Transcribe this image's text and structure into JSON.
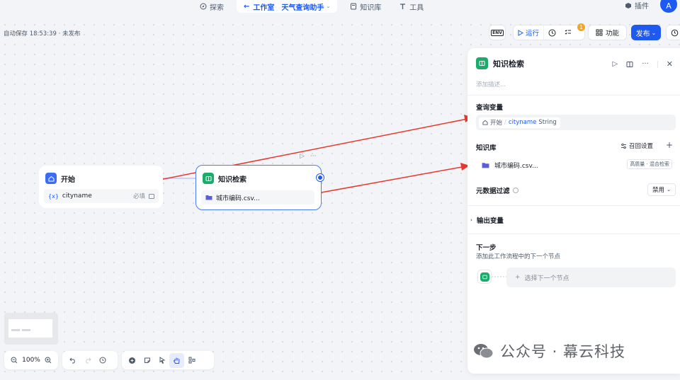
{
  "topnav": {
    "explore_label": "探索",
    "workspace_label": "工作室",
    "app_name": "天气查询助手",
    "knowledge_label": "知识库",
    "tools_label": "工具",
    "plugins_label": "插件",
    "avatar_initial": "A"
  },
  "autosave": {
    "text": "自动保存 18:53:39 · 未发布"
  },
  "toolbar": {
    "env_label": "ENV",
    "run_label": "运行",
    "issue_badge": "1",
    "features_label": "功能",
    "publish_label": "发布"
  },
  "nodes": {
    "start": {
      "title": "开始",
      "var_icon": "{x}",
      "var_name": "cityname",
      "required_label": "必填"
    },
    "knowledge": {
      "title": "知识检索",
      "dataset": "城市编码.csv..."
    }
  },
  "panel": {
    "title": "知识检索",
    "desc_placeholder": "添加描述...",
    "query_section": "查询变量",
    "query_source": "开始",
    "query_var": "cityname",
    "query_type": "String",
    "kb_section": "知识库",
    "recall_label": "召回设置",
    "dataset_name": "城市编码.csv...",
    "dataset_tag": "高质量 · 混合检索",
    "metadata_label": "元数据过滤",
    "metadata_value": "禁用",
    "output_label": "输出变量",
    "next_title": "下一步",
    "next_desc": "添加此工作流程中的下一个节点",
    "next_select": "选择下一个节点"
  },
  "bottom": {
    "zoom": "100%"
  },
  "watermark": {
    "text": "公众号 · 幕云科技"
  },
  "colors": {
    "accent": "#1e5af0",
    "start_icon": "#3b6cf6",
    "kb_icon": "#1aad6a",
    "arrow": "#e8382d",
    "badge": "#f5a623"
  }
}
